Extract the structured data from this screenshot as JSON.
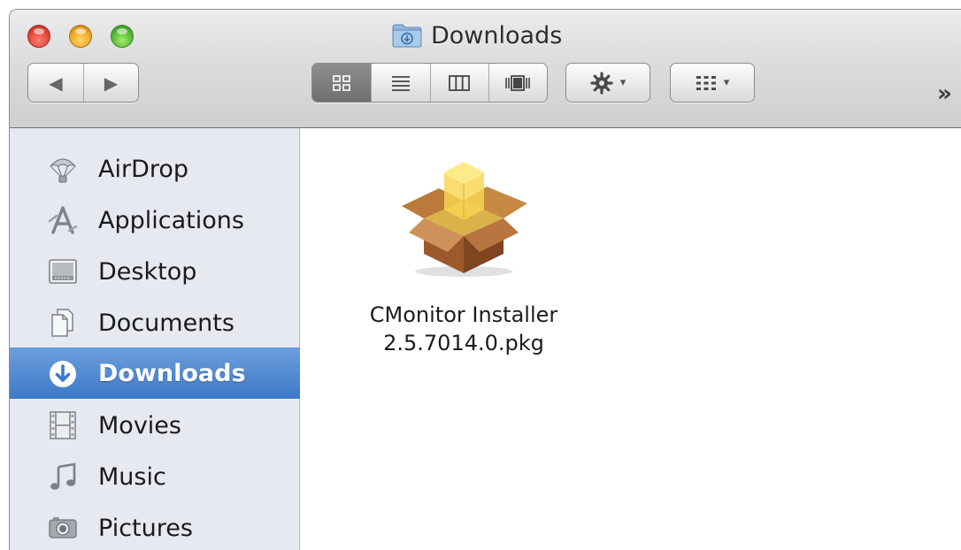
{
  "window": {
    "title": "Downloads"
  },
  "toolbar": {
    "back_glyph": "◀",
    "forward_glyph": "▶",
    "view_modes": [
      {
        "name": "icon-view",
        "glyph": "▦",
        "active": true
      },
      {
        "name": "list-view",
        "glyph": "☰",
        "active": false
      },
      {
        "name": "column-view",
        "glyph": "▥",
        "active": false
      },
      {
        "name": "cover-flow-view",
        "glyph": "▥",
        "active": false
      }
    ],
    "action_glyph": "✲",
    "arrange_glyph": "▤",
    "caret": "▾",
    "overflow": "»"
  },
  "sidebar": {
    "items": [
      {
        "label": "AirDrop",
        "icon": "airdrop-icon"
      },
      {
        "label": "Applications",
        "icon": "applications-icon"
      },
      {
        "label": "Desktop",
        "icon": "desktop-icon"
      },
      {
        "label": "Documents",
        "icon": "documents-icon"
      },
      {
        "label": "Downloads",
        "icon": "downloads-icon",
        "selected": true
      },
      {
        "label": "Movies",
        "icon": "movies-icon"
      },
      {
        "label": "Music",
        "icon": "music-icon"
      },
      {
        "label": "Pictures",
        "icon": "pictures-icon"
      }
    ]
  },
  "files": [
    {
      "name_line1": "CMonitor Installer",
      "name_line2": "2.5.7014.0.pkg",
      "icon": "package-icon"
    }
  ],
  "colors": {
    "selection": "#3d79c9",
    "sidebar_bg": "#e6eaf0",
    "package_box": "#b46a35",
    "package_tape": "#f2d25a"
  }
}
